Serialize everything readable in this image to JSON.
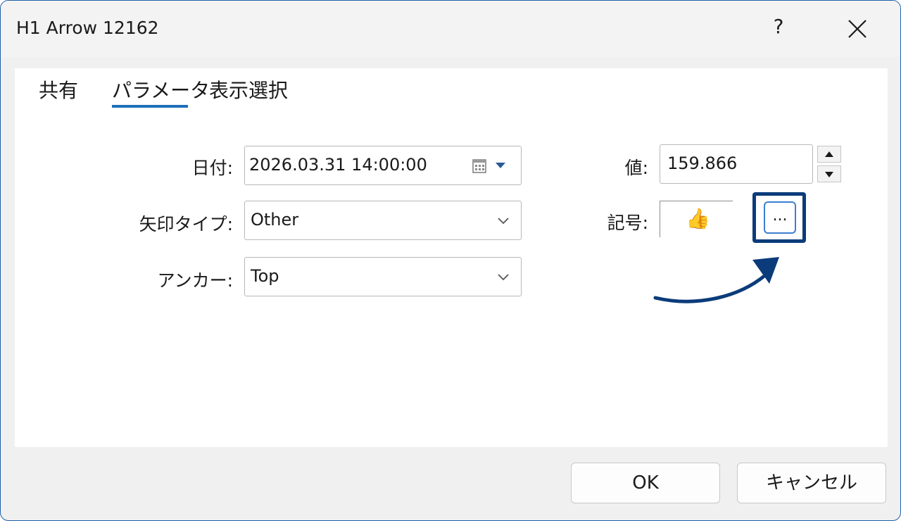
{
  "window": {
    "title": "H1 Arrow 12162",
    "help_label": "?"
  },
  "tabs": [
    {
      "label": "共有"
    },
    {
      "label": "パラメータ"
    },
    {
      "label": "表示選択"
    }
  ],
  "fields": {
    "date": {
      "label": "日付:",
      "value": "2026.03.31 14:00:00"
    },
    "arrow_type": {
      "label": "矢印タイプ:",
      "value": "Other"
    },
    "anchor": {
      "label": "アンカー:",
      "value": "Top"
    },
    "price": {
      "label": "値:",
      "value": "159.866"
    },
    "symbol": {
      "label": "記号:",
      "glyph": "👍",
      "browse_label": "..."
    }
  },
  "buttons": {
    "ok": "OK",
    "cancel": "キャンセル"
  },
  "colors": {
    "accent": "#1e6fb8",
    "highlight": "#0b3b7a"
  }
}
